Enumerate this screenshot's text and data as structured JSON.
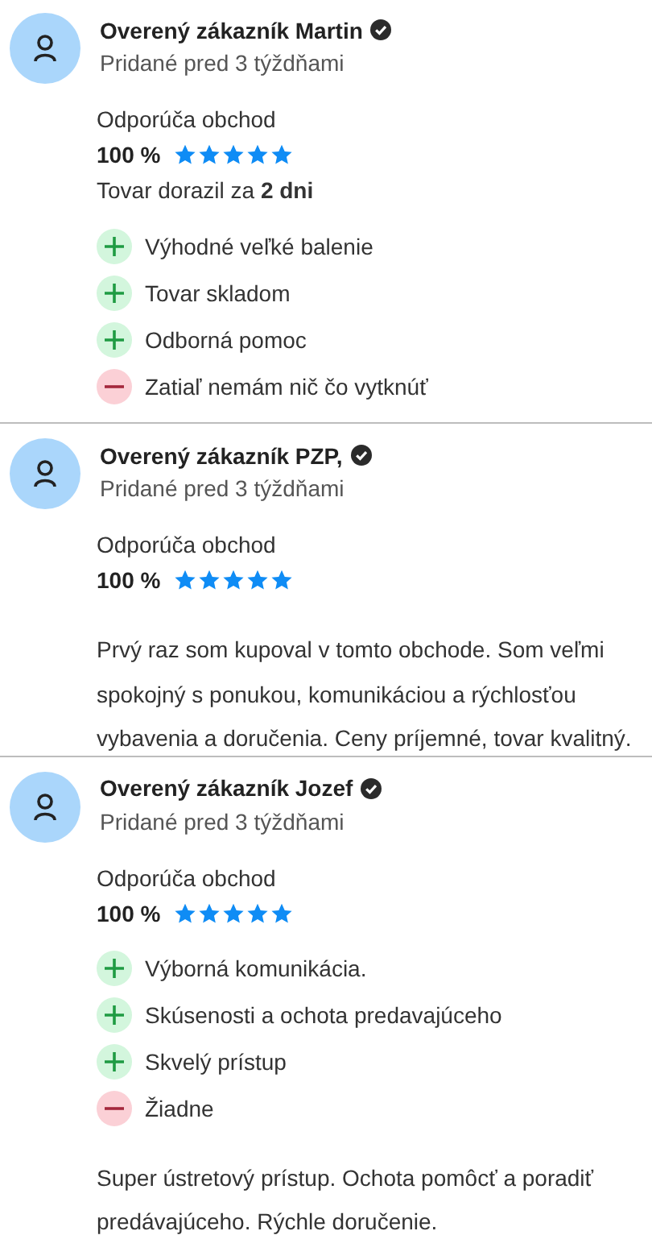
{
  "reviews": [
    {
      "name": "Overený zákazník Martin",
      "verified": true,
      "added": "Pridané pred 3 týždňami",
      "recommend": "Odporúča obchod",
      "percent": "100 %",
      "stars": 5,
      "delivery": "Tovar dorazil za **2 dni**",
      "points": [
        {
          "kind": "pro",
          "text": "Výhodné veľké balenie"
        },
        {
          "kind": "pro",
          "text": "Tovar skladom"
        },
        {
          "kind": "pro",
          "text": "Odborná pomoc"
        },
        {
          "kind": "con",
          "text": "Zatiaľ nemám nič čo vytknúť"
        }
      ]
    },
    {
      "name": "Overený zákazník PZP,",
      "verified": true,
      "added": "Pridané pred 3 týždňami",
      "recommend": "Odporúča obchod",
      "percent": "100 %",
      "stars": 5,
      "comment": "Prvý raz som kupoval v tomto obchode. Som veľmi spokojný s ponukou, komunikáciou a rýchlosťou vybavenia a doručenia. Ceny príjemné, tovar kvalitný."
    },
    {
      "name": "Overený zákazník Jozef",
      "verified": true,
      "added": "Pridané pred 3 týždňami",
      "recommend": "Odporúča obchod",
      "percent": "100 %",
      "stars": 5,
      "points": [
        {
          "kind": "pro",
          "text": "Výborná komunikácia."
        },
        {
          "kind": "pro",
          "text": "Skúsenosti a ochota predavajúceho"
        },
        {
          "kind": "pro",
          "text": "Skvelý prístup"
        },
        {
          "kind": "con",
          "text": "Žiadne"
        }
      ],
      "comment": "Super ústretový prístup. Ochota pomôcť a poradiť predávajúceho. Rýchle doručenie."
    }
  ]
}
